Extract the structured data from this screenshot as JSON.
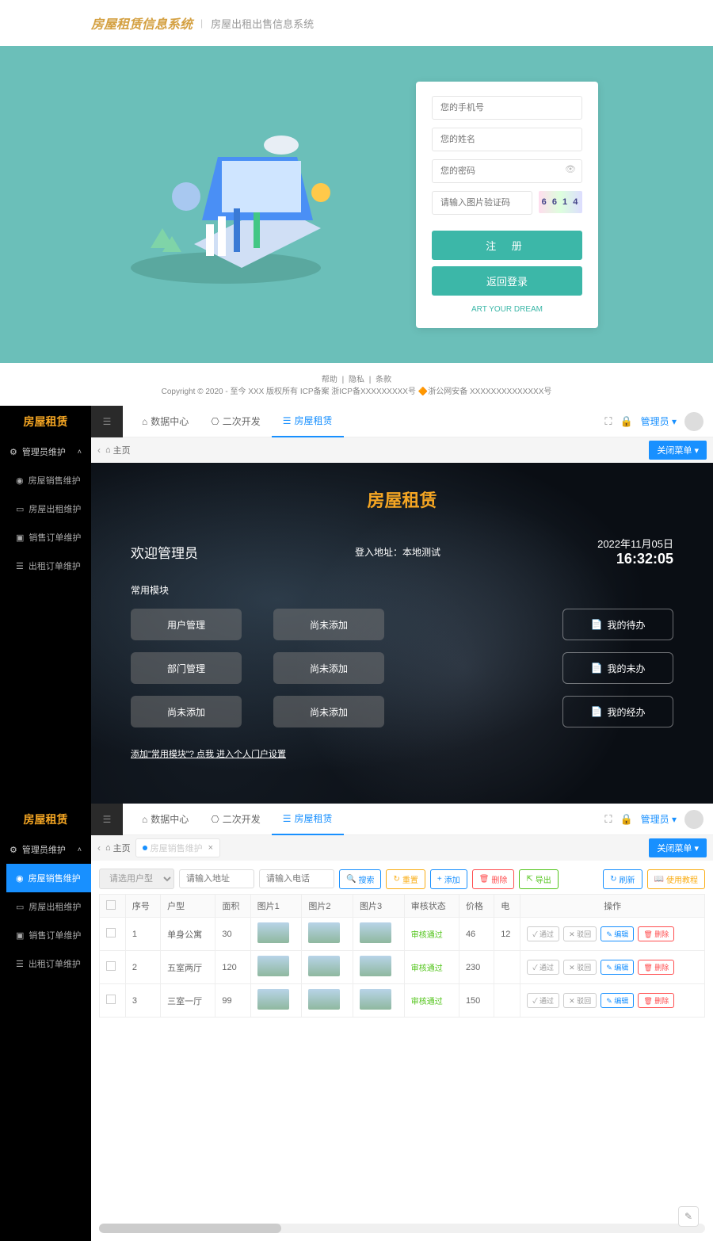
{
  "registration": {
    "logo": "房屋租赁信息系统",
    "subtitle": "房屋出租出售信息系统",
    "phone_placeholder": "您的手机号",
    "name_placeholder": "您的姓名",
    "password_placeholder": "您的密码",
    "captcha_placeholder": "请输入图片验证码",
    "captcha_text": "6 6 1 4",
    "register_btn": "注 册",
    "back_login_btn": "返回登录",
    "slogan": "ART YOUR DREAM",
    "footer_links": [
      "帮助",
      "隐私",
      "条款"
    ],
    "copyright": "Copyright © 2020 - 至今 XXX 版权所有 ICP备案 浙ICP备XXXXXXXXX号 🔶浙公网安备 XXXXXXXXXXXXXX号"
  },
  "dashboard_panel": {
    "brand": "房屋租赁",
    "sidebar": {
      "parent": "管理员维护",
      "items": [
        "房屋销售维护",
        "房屋出租维护",
        "销售订单维护",
        "出租订单维护"
      ]
    },
    "topbar": {
      "tabs": [
        {
          "icon": "⌂",
          "label": "数据中心",
          "active": false
        },
        {
          "icon": "⎔",
          "label": "二次开发",
          "active": false
        },
        {
          "icon": "☰",
          "label": "房屋租赁",
          "active": true
        }
      ],
      "user": "管理员",
      "close_menu": "关闭菜单 ▾"
    },
    "breadcrumb_home": "主页",
    "dashboard": {
      "title": "房屋租赁",
      "welcome": "欢迎管理员",
      "login_info_label": "登入地址：",
      "login_info_value": "本地测试",
      "date": "2022年11月05日",
      "time": "16:32:05",
      "modules_label": "常用模块",
      "left_modules": [
        "用户管理",
        "部门管理",
        "尚未添加"
      ],
      "mid_modules": [
        "尚未添加",
        "尚未添加",
        "尚未添加"
      ],
      "right_modules": [
        "我的待办",
        "我的未办",
        "我的经办"
      ],
      "add_link": "添加\"常用模块\"? 点我 进入个人门户设置"
    }
  },
  "table_panel": {
    "brand": "房屋租赁",
    "sidebar": {
      "parent": "管理员维护",
      "items": [
        "房屋销售维护",
        "房屋出租维护",
        "销售订单维护",
        "出租订单维护"
      ],
      "active_index": 0
    },
    "topbar": {
      "tabs": [
        {
          "icon": "⌂",
          "label": "数据中心",
          "active": false
        },
        {
          "icon": "⎔",
          "label": "二次开发",
          "active": false
        },
        {
          "icon": "☰",
          "label": "房屋租赁",
          "active": true
        }
      ],
      "user": "管理员",
      "close_menu": "关闭菜单 ▾"
    },
    "breadcrumb_home": "主页",
    "breadcrumb_tab": "房屋销售维护",
    "filters": {
      "user_type": "请选用户型",
      "address": "请输入地址",
      "phone": "请输入电话",
      "search": "搜索",
      "reset": "重置",
      "add": "添加",
      "delete": "删除",
      "export": "导出",
      "refresh": "刷新",
      "tutorial": "使用教程"
    },
    "columns": [
      "",
      "序号",
      "户型",
      "面积",
      "图片1",
      "图片2",
      "图片3",
      "审核状态",
      "价格",
      "电",
      "操作"
    ],
    "rows": [
      {
        "seq": "1",
        "type": "单身公寓",
        "area": "30",
        "status": "审核通过",
        "price": "46",
        "elec": "12"
      },
      {
        "seq": "2",
        "type": "五室两厅",
        "area": "120",
        "status": "审核通过",
        "price": "230",
        "elec": ""
      },
      {
        "seq": "3",
        "type": "三室一厅",
        "area": "99",
        "status": "审核通过",
        "price": "150",
        "elec": ""
      }
    ],
    "actions": {
      "pass": "通过",
      "reject": "驳回",
      "edit": "编辑",
      "del": "删除"
    }
  }
}
